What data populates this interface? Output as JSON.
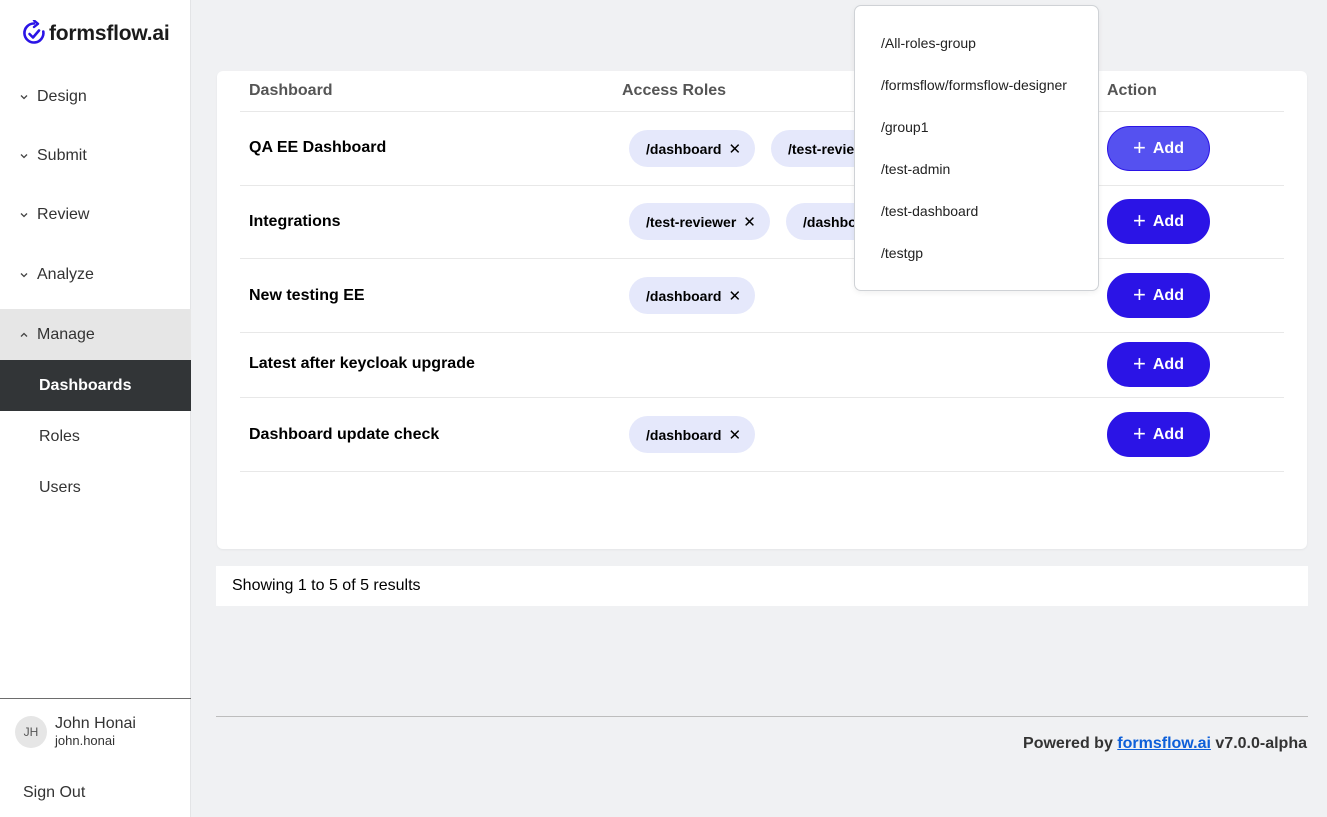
{
  "brand": {
    "name": "formsflow.ai",
    "accent": "#2b14e6"
  },
  "sidebar": {
    "sections": [
      {
        "label": "Design",
        "expanded": false
      },
      {
        "label": "Submit",
        "expanded": false
      },
      {
        "label": "Review",
        "expanded": false
      },
      {
        "label": "Analyze",
        "expanded": false
      },
      {
        "label": "Manage",
        "expanded": true
      }
    ],
    "manage_items": [
      {
        "label": "Dashboards",
        "active": true
      },
      {
        "label": "Roles",
        "active": false
      },
      {
        "label": "Users",
        "active": false
      }
    ],
    "user": {
      "initials": "JH",
      "name": "John Honai",
      "handle": "john.honai"
    },
    "sign_out": "Sign Out"
  },
  "table": {
    "headers": {
      "dashboard": "Dashboard",
      "roles": "Access Roles",
      "action": "Action"
    },
    "add_label": "Add",
    "rows": [
      {
        "name": "QA EE Dashboard",
        "roles": [
          "/dashboard",
          "/test-reviewer"
        ]
      },
      {
        "name": "Integrations",
        "roles": [
          "/test-reviewer",
          "/dashboard"
        ]
      },
      {
        "name": "New testing EE",
        "roles": [
          "/dashboard"
        ]
      },
      {
        "name": "Latest after keycloak upgrade",
        "roles": []
      },
      {
        "name": "Dashboard update check",
        "roles": [
          "/dashboard"
        ]
      }
    ]
  },
  "pagination": {
    "summary": "Showing 1 to 5 of 5 results"
  },
  "footer": {
    "prefix": "Powered by",
    "link": "formsflow.ai",
    "version": "v7.0.0-alpha"
  },
  "dropdown": {
    "options": [
      "/All-roles-group",
      "/formsflow/formsflow-designer",
      "/group1",
      "/test-admin",
      "/test-dashboard",
      "/testgp"
    ]
  }
}
